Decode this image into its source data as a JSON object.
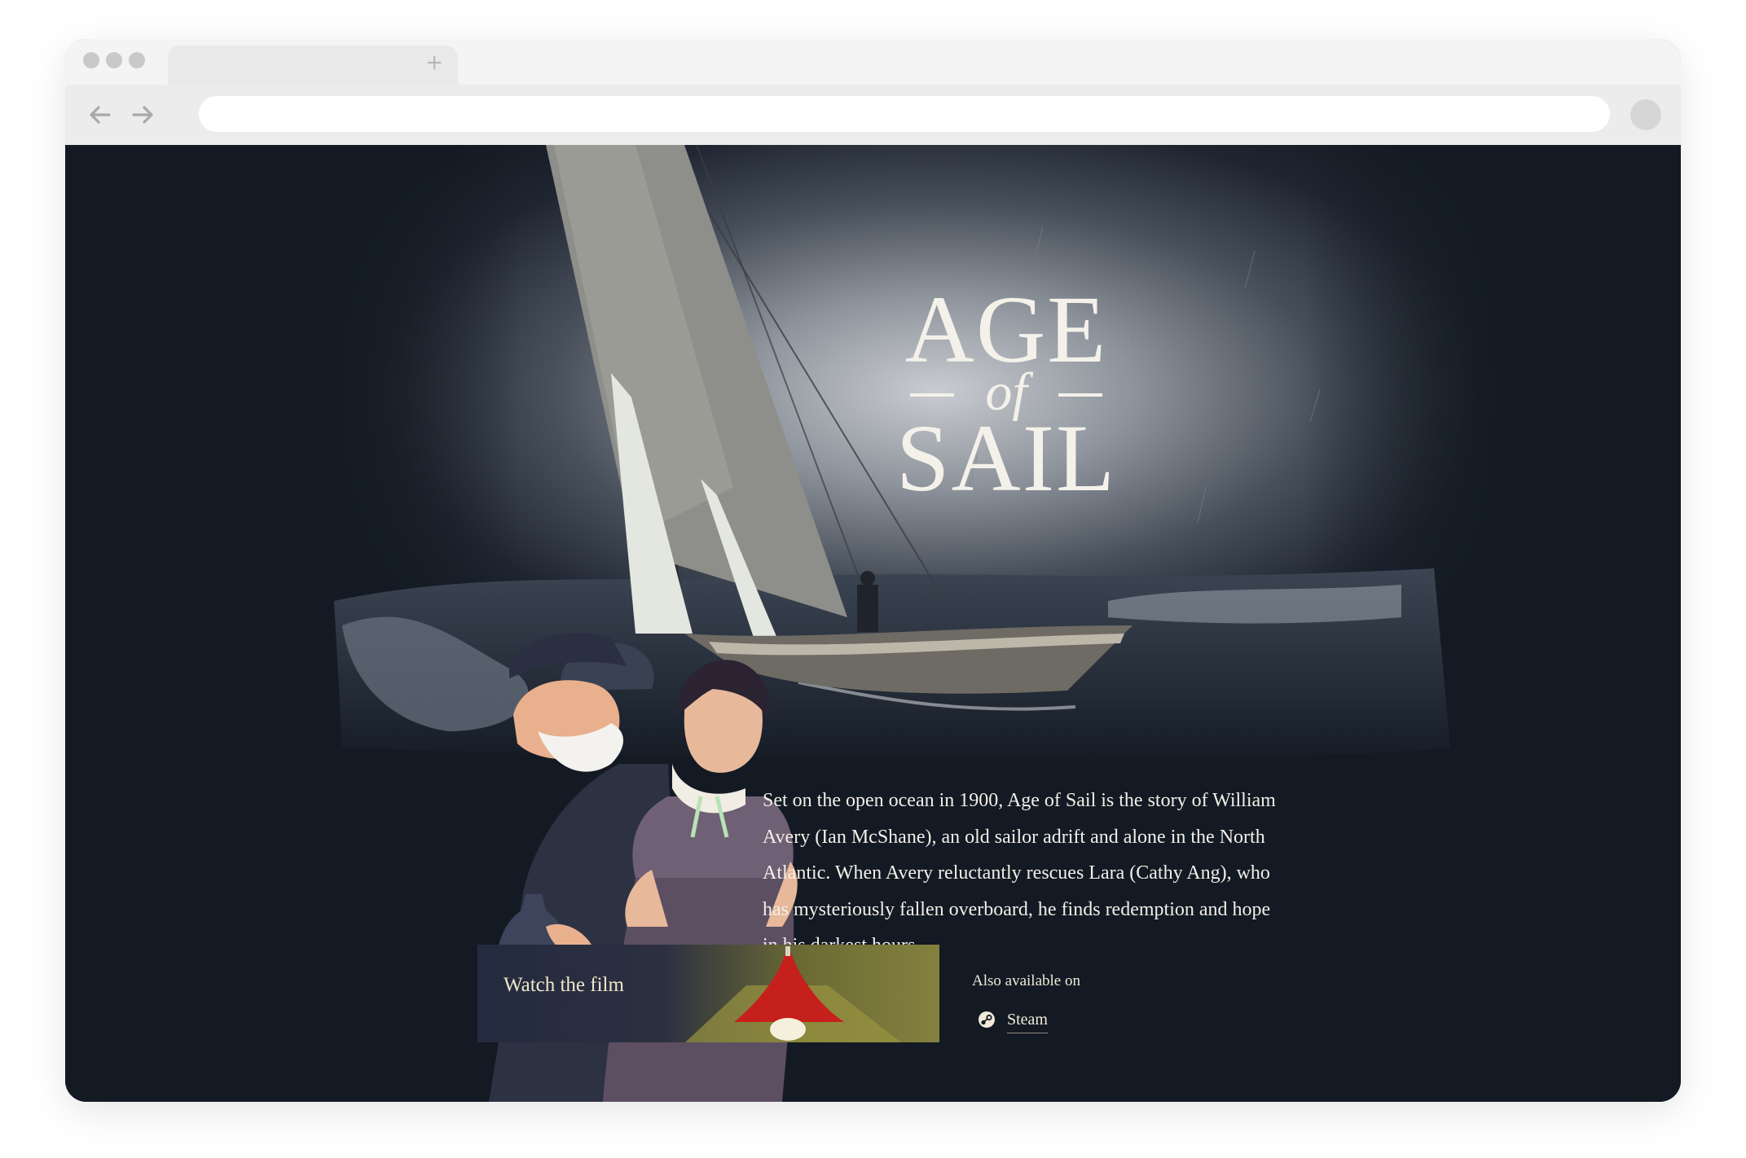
{
  "browser": {
    "new_tab_symbol": "+",
    "address_value": "",
    "icons": {
      "back": "arrow-left-icon",
      "forward": "arrow-right-icon",
      "new_tab": "plus-icon",
      "profile": "profile-avatar"
    }
  },
  "hero": {
    "title_top": "AGE",
    "title_mid": "of",
    "title_bottom": "SAIL"
  },
  "synopsis": {
    "text": "Set on the open ocean in 1900, Age of Sail is the story of William Avery (Ian McShane), an old sailor adrift and alone in the North Atlantic. When Avery reluctantly rescues Lara (Cathy Ang), who has mysteriously fallen overboard, he finds redemption and hope in his darkest hours."
  },
  "watch": {
    "label": "Watch the film"
  },
  "availability": {
    "label": "Also available on",
    "platforms": [
      {
        "name": "Steam",
        "icon": "steam-icon"
      }
    ]
  },
  "colors": {
    "page_bg": "#131a23",
    "chrome_bg": "#f5f5f5",
    "text_light": "#f2efe8",
    "card_bg": "#242a3f",
    "lamp_red": "#c5201c"
  }
}
